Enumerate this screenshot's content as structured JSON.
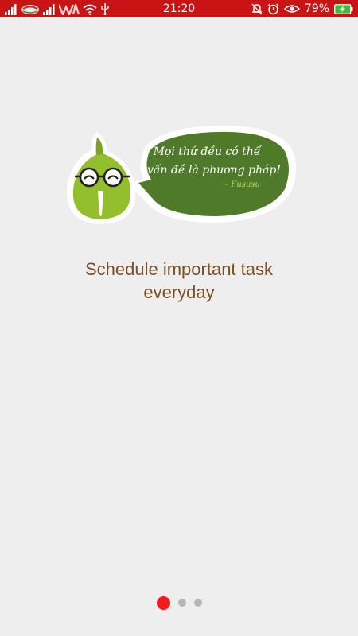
{
  "status_bar": {
    "time": "21:20",
    "battery_percent": "79%",
    "background_color": "#c81414",
    "icons_left": [
      "signal-icon",
      "carrier-logo-icon",
      "signal-icon",
      "carrier-logo-icon",
      "wifi-icon",
      "usb-icon"
    ],
    "icons_right": [
      "mute-bell-icon",
      "alarm-icon",
      "eye-icon",
      "battery-charging-icon"
    ]
  },
  "illustration": {
    "quote_line_1": "Mọi thứ đều có thể",
    "quote_line_2": "vấn đề là phương pháp!",
    "signature": "~ Fususu",
    "bubble_color": "#4f7a2a",
    "mascot_color": "#93bf2d"
  },
  "headline": {
    "line_1": "Schedule important task",
    "line_2": "everyday",
    "color": "#7a4f25"
  },
  "pager": {
    "page_count": 3,
    "active_page": 1,
    "active_color": "#ee1c1c",
    "inactive_color": "#b5b5b5"
  }
}
